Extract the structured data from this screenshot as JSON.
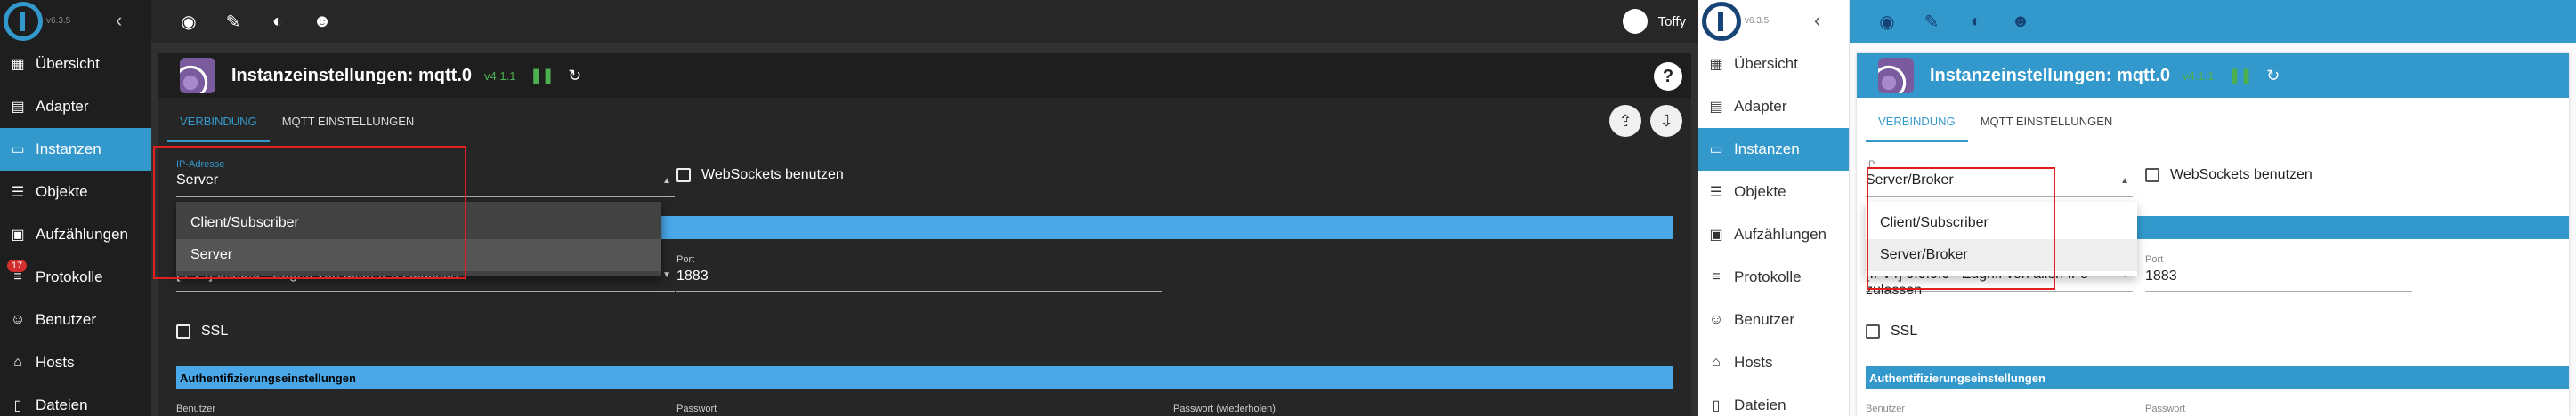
{
  "app": {
    "version": "v6.3.5",
    "user": "Toffy"
  },
  "sidebar": {
    "items": [
      {
        "label": "Übersicht",
        "icon": "grid-icon"
      },
      {
        "label": "Adapter",
        "icon": "store-icon"
      },
      {
        "label": "Instanzen",
        "icon": "instances-icon",
        "active": true
      },
      {
        "label": "Objekte",
        "icon": "list-icon"
      },
      {
        "label": "Aufzählungen",
        "icon": "enum-icon"
      },
      {
        "label": "Protokolle",
        "icon": "log-icon",
        "badge": "17"
      },
      {
        "label": "Benutzer",
        "icon": "user-icon"
      },
      {
        "label": "Hosts",
        "icon": "hosts-icon"
      },
      {
        "label": "Dateien",
        "icon": "files-icon"
      }
    ]
  },
  "topbar": {
    "icons": [
      "eye-icon",
      "wrench-icon",
      "theme-icon",
      "expert-icon"
    ]
  },
  "instance": {
    "title": "Instanzeinstellungen: mqtt.0",
    "version": "v4.1.1"
  },
  "tabs": [
    "VERBINDUNG",
    "MQTT EINSTELLUNGEN"
  ],
  "dark": {
    "type_label": "IP-Adresse",
    "type_value": "Server",
    "options": [
      "Client/Subscriber",
      "Server"
    ],
    "selected_option": "Server"
  },
  "light": {
    "type_label": "IP",
    "type_value": "Server/Broker",
    "options": [
      "Client/Subscriber",
      "Server/Broker"
    ],
    "selected_option": "Server/Broker"
  },
  "form": {
    "websockets_label": "WebSockets benutzen",
    "bind_value": "[IPv4] 0.0.0.0 - Zugriff von allen IPs zulassen",
    "port_label": "Port",
    "port_value": "1883",
    "ssl_label": "SSL",
    "auth_header": "Authentifizierungseinstellungen",
    "user_label": "Benutzer",
    "password_label": "Passwort",
    "password_repeat_label": "Passwort (wiederholen)"
  },
  "colors": {
    "accent": "#3399cc",
    "highlight": "#e02020",
    "running": "#4caf50"
  }
}
